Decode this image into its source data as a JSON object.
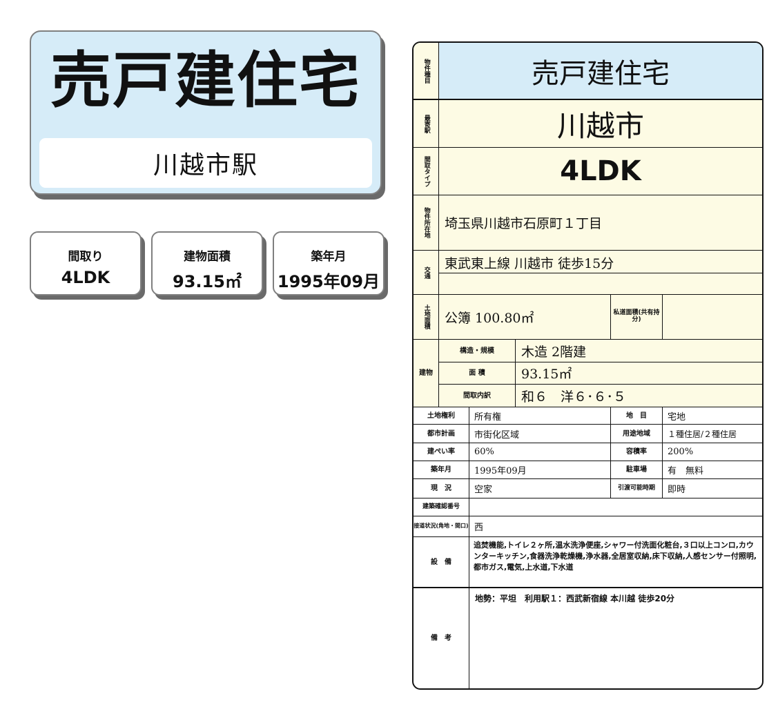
{
  "hero": {
    "title": "売戸建住宅",
    "station": "川越市駅"
  },
  "summary": [
    {
      "label": "間取り",
      "value": "4LDK"
    },
    {
      "label": "建物面積",
      "value": "93.15㎡"
    },
    {
      "label": "築年月",
      "value": "1995年09月"
    }
  ],
  "sheet": {
    "type_label": "物件種目",
    "type": "売戸建住宅",
    "station_label": "最寄駅",
    "station": "川越市",
    "layout_label": "間取タイプ",
    "layout": "4LDK",
    "address_label": "物件所在地",
    "address": "埼玉県川越市石原町１丁目",
    "traffic_label": "交通",
    "traffic": "東武東上線 川越市 徒歩15分",
    "land_label": "土地面積",
    "land": "公簿 100.80㎡",
    "private_road_label": "私道面積(共有持分)",
    "private_road": "",
    "building_label": "建物",
    "structure_label": "構造・規模",
    "structure": "木造 2階建",
    "area_label": "面 積",
    "area": "93.15㎡",
    "rooms_label": "間取内訳",
    "rooms": "和６　洋６･６･５",
    "land_right_label": "土地権利",
    "land_right": "所有権",
    "chimoku_label": "地　目",
    "chimoku": "宅地",
    "city_plan_label": "都市計画",
    "city_plan": "市街化区域",
    "zoning_label": "用途地域",
    "zoning": "１種住居/２種住居",
    "bcr_label": "建ぺい率",
    "bcr": "60%",
    "far_label": "容積率",
    "far": "200%",
    "built_label": "築年月",
    "built": "1995年09月",
    "parking_label": "駐車場",
    "parking": "有　無料",
    "status_label": "現　況",
    "status": "空家",
    "handover_label": "引渡可能時期",
    "handover": "即時",
    "confirm_label": "建築確認番号",
    "confirm": "",
    "road_label": "接道状況(角地・間口)",
    "road": "西",
    "equip_label": "設　備",
    "equip": "追焚機能,トイレ２ヶ所,温水洗浄便座,シャワー付洗面化粧台,３口以上コンロ,カウンターキッチン,食器洗浄乾燥機,浄水器,全居室収納,床下収納,人感センサー付照明,都市ガス,電気,上水道,下水道",
    "notes_label": "備　考",
    "notes": "地勢：平坦　利用駅１：西武新宿線 本川越 徒歩20分"
  }
}
